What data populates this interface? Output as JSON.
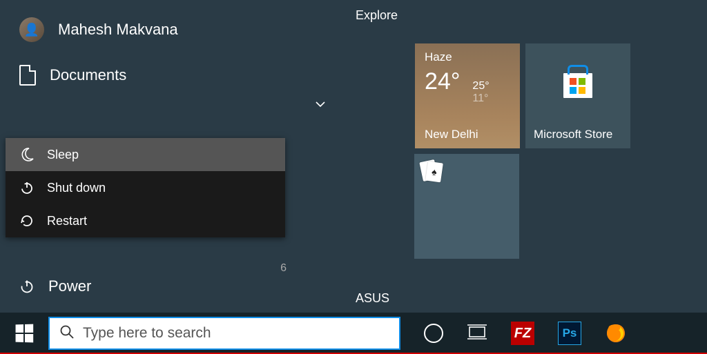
{
  "user": {
    "name": "Mahesh Makvana"
  },
  "sidebar": {
    "documents_label": "Documents",
    "power_label": "Power"
  },
  "power_menu": {
    "items": [
      {
        "label": "Sleep",
        "icon": "moon-icon",
        "highlighted": true
      },
      {
        "label": "Shut down",
        "icon": "power-icon",
        "highlighted": false
      },
      {
        "label": "Restart",
        "icon": "restart-icon",
        "highlighted": false
      }
    ]
  },
  "misc_number": "6",
  "tiles": {
    "group_labels": {
      "explore": "Explore",
      "asus": "ASUS"
    },
    "weather": {
      "condition": "Haze",
      "temperature": "24°",
      "high": "25°",
      "low": "11°",
      "city": "New Delhi"
    },
    "store": {
      "label": "Microsoft Store"
    }
  },
  "taskbar": {
    "search_placeholder": "Type here to search",
    "apps": {
      "filezilla": "FZ",
      "photoshop": "Ps"
    }
  }
}
